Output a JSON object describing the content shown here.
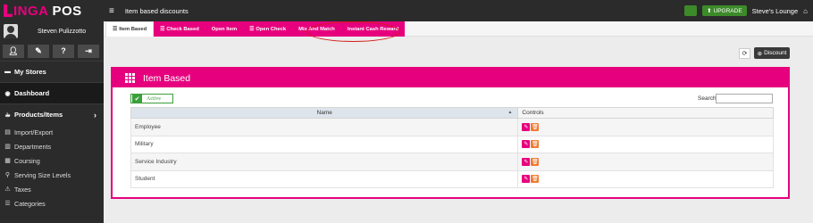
{
  "brand": {
    "logo_text_1": "L",
    "logo_text_2": "INGA",
    "logo_text_3": "POS"
  },
  "user": {
    "name": "Steven Pulizzotto"
  },
  "toolbar_icons": [
    "user-icon",
    "pencil-icon",
    "help-icon",
    "logout-icon"
  ],
  "sidebar": {
    "items": [
      {
        "label": "My Stores",
        "icon": "store-icon",
        "major": true
      },
      {
        "label": "Dashboard",
        "icon": "dashboard-icon",
        "major": true,
        "active": true
      },
      {
        "label": "Products/Items",
        "icon": "products-icon",
        "major": true,
        "chevron": "›"
      },
      {
        "label": "Import/Export",
        "icon": "import-icon"
      },
      {
        "label": "Departments",
        "icon": "departments-icon"
      },
      {
        "label": "Coursing",
        "icon": "coursing-icon"
      },
      {
        "label": "Serving Size Levels",
        "icon": "serving-size-icon"
      },
      {
        "label": "Taxes",
        "icon": "taxes-icon"
      },
      {
        "label": "Categories",
        "icon": "categories-icon"
      }
    ]
  },
  "header": {
    "title": "Item based discounts",
    "upgrade_label": "UPGRADE",
    "store_name": "Steve's Lounge"
  },
  "tabs": [
    {
      "label": "Item Based",
      "active": true
    },
    {
      "label": "Check Based"
    },
    {
      "label": "Open Item"
    },
    {
      "label": "Open Check"
    },
    {
      "label": "Mix And Match"
    },
    {
      "label": "Instant Cash Reward"
    }
  ],
  "actions": {
    "refresh_icon": "refresh-icon",
    "discount_label": "Discount"
  },
  "panel": {
    "title": "Item Based",
    "active_label": "Active",
    "search_label": "Search",
    "search_value": "",
    "columns": [
      "Name",
      "Controls"
    ],
    "rows": [
      {
        "name": "Employee"
      },
      {
        "name": "Military"
      },
      {
        "name": "Service Industry"
      },
      {
        "name": "Student"
      }
    ]
  },
  "colors": {
    "accent": "#e6007e",
    "sidebar_bg": "#2b2b2b",
    "success": "#3aa03a",
    "delete": "#f27a33",
    "annotation": "#d21a1a"
  }
}
